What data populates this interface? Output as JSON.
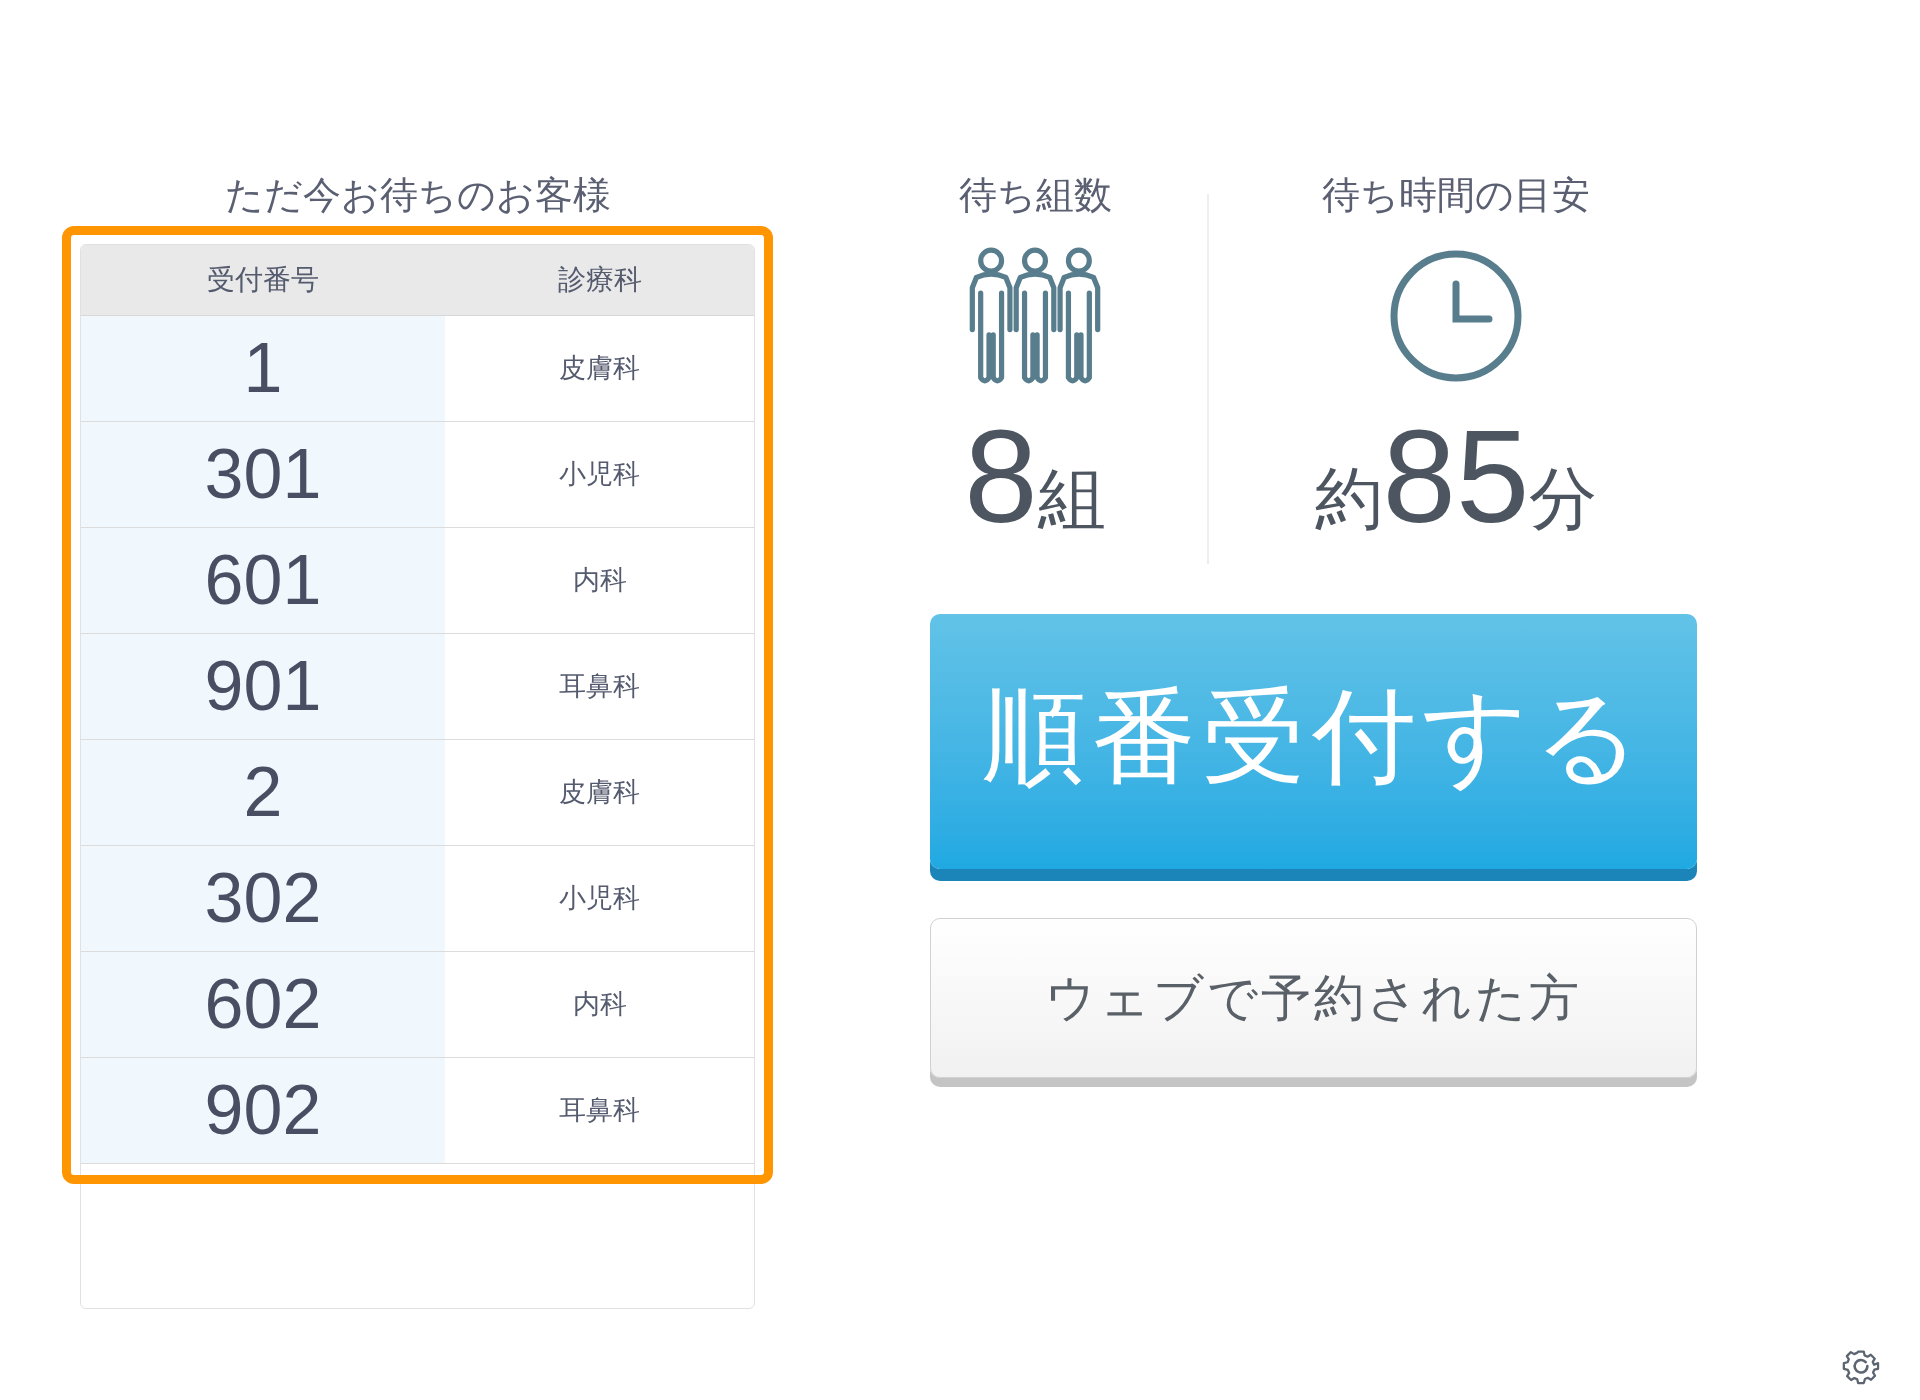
{
  "waiting_list": {
    "title": "ただ今お待ちのお客様",
    "columns": [
      "受付番号",
      "診療科"
    ],
    "rows": [
      {
        "number": "1",
        "department": "皮膚科"
      },
      {
        "number": "301",
        "department": "小児科"
      },
      {
        "number": "601",
        "department": "内科"
      },
      {
        "number": "901",
        "department": "耳鼻科"
      },
      {
        "number": "2",
        "department": "皮膚科"
      },
      {
        "number": "302",
        "department": "小児科"
      },
      {
        "number": "602",
        "department": "内科"
      },
      {
        "number": "902",
        "department": "耳鼻科"
      }
    ]
  },
  "stats": [
    {
      "kind": "groups",
      "label": "待ち組数",
      "value": "8",
      "unit": "組"
    },
    {
      "kind": "time",
      "label": "待ち時間の目安",
      "prefix": "約",
      "value": "85",
      "unit": "分"
    }
  ],
  "buttons": [
    {
      "kind": "primary",
      "label": "順番受付する"
    },
    {
      "kind": "secondary",
      "label": "ウェブで予約された方"
    }
  ]
}
